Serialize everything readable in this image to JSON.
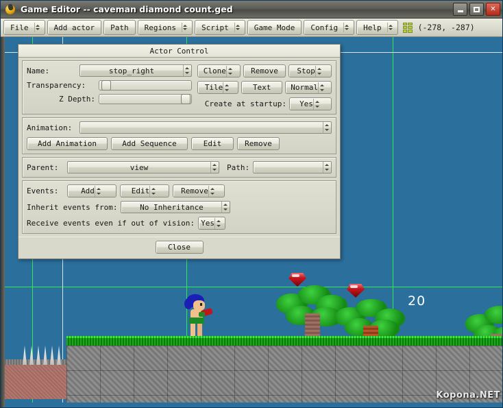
{
  "window": {
    "title": "Game Editor -- caveman diamond count.ged",
    "icon": "game-editor-icon",
    "buttons": {
      "minimize": "minimize-icon",
      "maximize": "maximize-icon",
      "close": "close-icon"
    }
  },
  "menubar": {
    "items": [
      {
        "label": "File",
        "has_dropdown": true
      },
      {
        "label": "Add actor",
        "has_dropdown": false
      },
      {
        "label": "Path",
        "has_dropdown": false
      },
      {
        "label": "Regions",
        "has_dropdown": true
      },
      {
        "label": "Script",
        "has_dropdown": true
      },
      {
        "label": "Game Mode",
        "has_dropdown": false
      },
      {
        "label": "Config",
        "has_dropdown": true
      },
      {
        "label": "Help",
        "has_dropdown": true
      }
    ],
    "grid_icon": "grid-toggle-icon",
    "coordinates": "(-278, -287)"
  },
  "dialog": {
    "title": "Actor Control",
    "name_label": "Name:",
    "name_value": "stop_right",
    "transparency_label": "Transparency:",
    "transparency_percent": 3,
    "zdepth_label": "Z Depth:",
    "zdepth_percent": 92,
    "clone_label": "Clone",
    "remove_label": "Remove",
    "stop_label": "Stop",
    "tile_label": "Tile",
    "text_label": "Text",
    "normal_label": "Normal",
    "create_at_startup_label": "Create at startup:",
    "create_at_startup_value": "Yes",
    "animation_label": "Animation:",
    "animation_value": "",
    "add_animation_label": "Add Animation",
    "add_sequence_label": "Add Sequence",
    "edit_label": "Edit",
    "remove_anim_label": "Remove",
    "parent_label": "Parent:",
    "parent_value": "view",
    "path_label": "Path:",
    "path_value": "",
    "events_label": "Events:",
    "events_add_label": "Add",
    "events_edit_label": "Edit",
    "events_remove_label": "Remove",
    "inherit_label": "Inherit events from:",
    "inherit_value": "No Inheritance",
    "receive_label": "Receive events even if out of vision:",
    "receive_value": "Yes",
    "close_label": "Close"
  },
  "scene": {
    "score": "20",
    "watermark": "Kopona.NET",
    "background_color": "#2b6f9c",
    "grid_color": "#2ef04a",
    "guide_color": "#f2f2f2"
  }
}
